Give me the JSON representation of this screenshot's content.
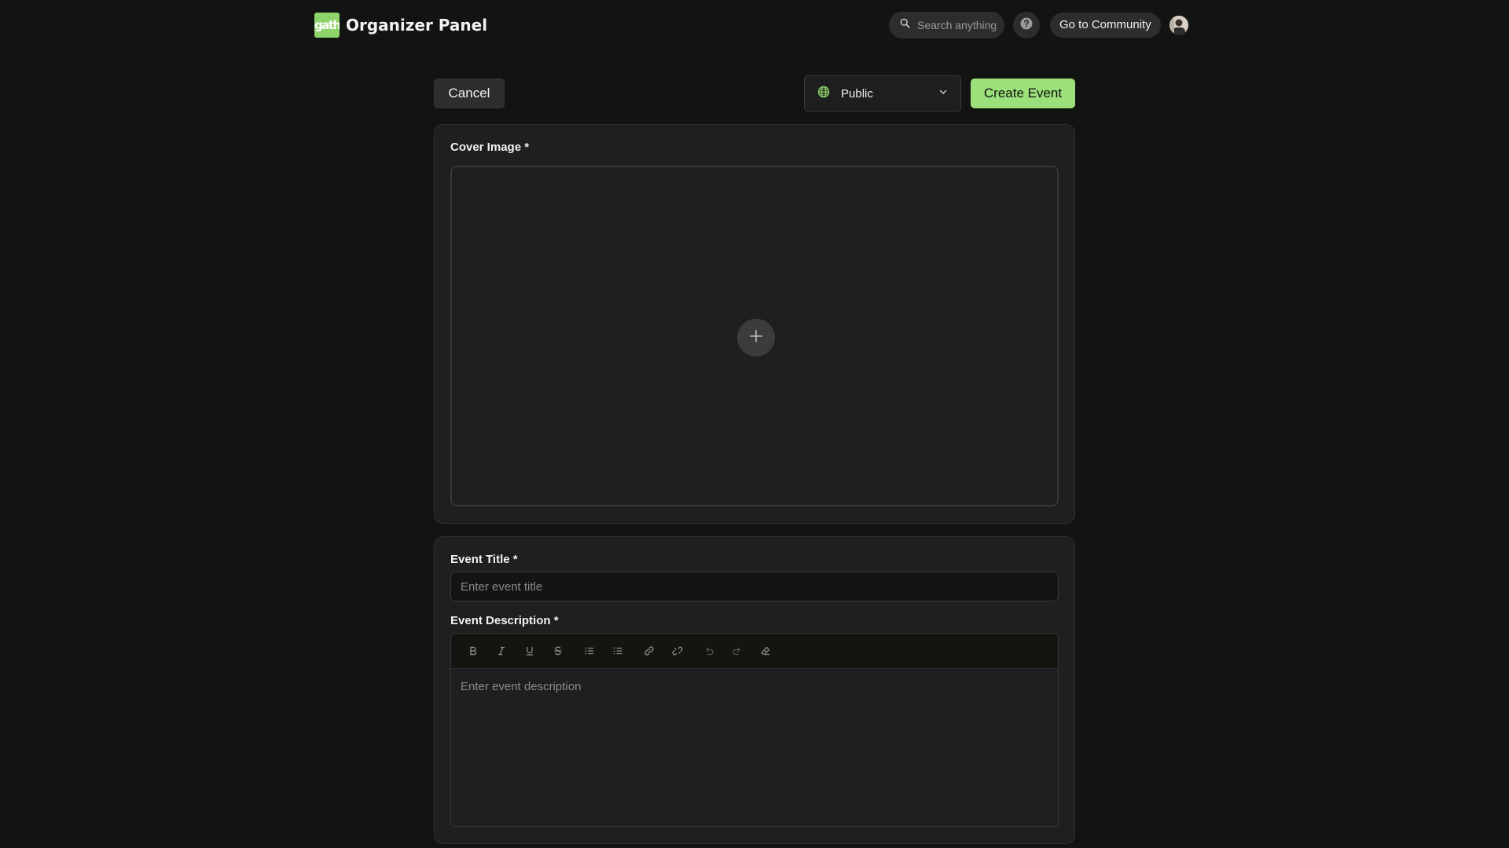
{
  "header": {
    "logo_text": "gath",
    "title": "Organizer Panel",
    "search_placeholder": "Search anything",
    "community_label": "Go to Community",
    "icons": [
      "search-icon",
      "help-icon",
      "avatar"
    ]
  },
  "actions": {
    "cancel_label": "Cancel",
    "visibility_selected": "Public",
    "visibility_icon": "globe-icon",
    "create_label": "Create Event"
  },
  "cover": {
    "label": "Cover Image *",
    "add_icon": "plus-icon"
  },
  "details": {
    "title_label": "Event Title *",
    "title_placeholder": "Enter event title",
    "description_label": "Event Description *",
    "description_placeholder": "Enter event description",
    "toolbar": [
      "bold-icon",
      "italic-icon",
      "underline-icon",
      "strikethrough-icon",
      "bullet-list-icon",
      "ordered-list-icon",
      "link-icon",
      "unlink-icon",
      "undo-icon",
      "redo-icon",
      "clear-format-icon"
    ]
  },
  "colors": {
    "accent": "#9be07a",
    "background": "#121412",
    "card": "#1e1f21"
  }
}
